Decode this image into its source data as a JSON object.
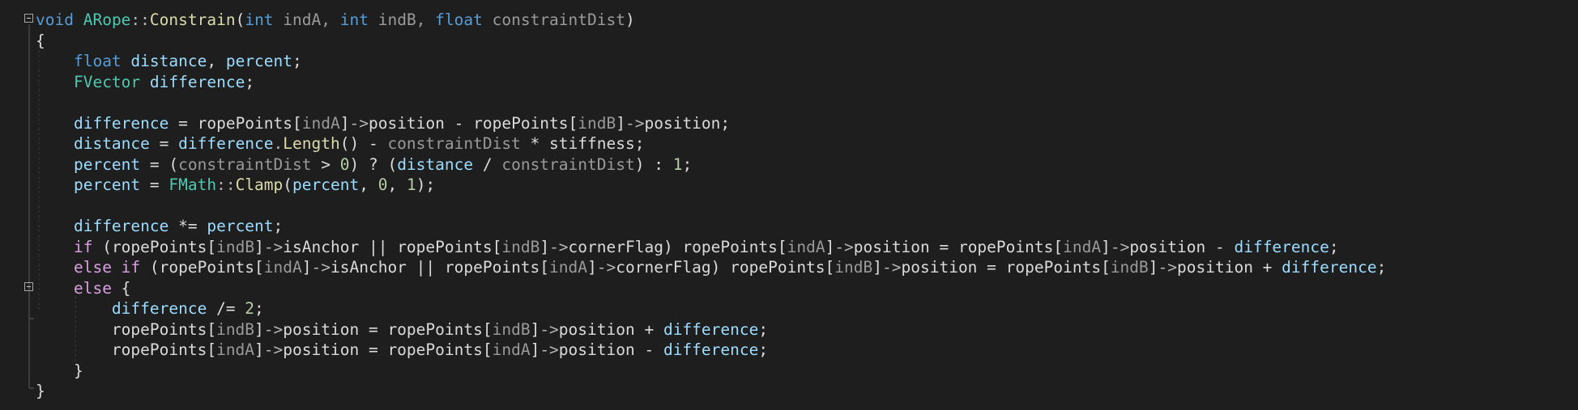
{
  "editor": {
    "language": "C++",
    "colors": {
      "background": "#1e1e1e",
      "keyword": "#569cd6",
      "control": "#d8a0df",
      "type": "#4ec9b0",
      "function": "#dcdcaa",
      "variable": "#9cdcfe",
      "parameter": "#9a9a9a",
      "number": "#b5cea8",
      "operator": "#b4b4b4",
      "member": "#dadada"
    },
    "fold_markers": [
      "collapse-icon",
      "collapse-icon"
    ],
    "lines": [
      [
        [
          "void",
          "keyword"
        ],
        [
          " ",
          "punct"
        ],
        [
          "ARope",
          "type"
        ],
        [
          "::",
          "operator"
        ],
        [
          "Constrain",
          "function"
        ],
        [
          "(",
          "punct"
        ],
        [
          "int",
          "keyword"
        ],
        [
          " indA, ",
          "parameter"
        ],
        [
          "int",
          "keyword"
        ],
        [
          " indB, ",
          "parameter"
        ],
        [
          "float",
          "keyword"
        ],
        [
          " constraintDist",
          "parameter"
        ],
        [
          ")",
          "punct"
        ]
      ],
      [
        [
          "{",
          "punct"
        ]
      ],
      [
        [
          "    ",
          "punct"
        ],
        [
          "float",
          "keyword"
        ],
        [
          " ",
          "punct"
        ],
        [
          "distance",
          "variable"
        ],
        [
          ", ",
          "punct"
        ],
        [
          "percent",
          "variable"
        ],
        [
          ";",
          "punct"
        ]
      ],
      [
        [
          "    ",
          "punct"
        ],
        [
          "FVector",
          "type"
        ],
        [
          " ",
          "punct"
        ],
        [
          "difference",
          "variable"
        ],
        [
          ";",
          "punct"
        ]
      ],
      [],
      [
        [
          "    ",
          "punct"
        ],
        [
          "difference",
          "variable"
        ],
        [
          " = ",
          "punct"
        ],
        [
          "ropePoints",
          "member"
        ],
        [
          "[",
          "punct"
        ],
        [
          "indA",
          "parameter"
        ],
        [
          "]",
          "punct"
        ],
        [
          "->",
          "operator"
        ],
        [
          "position",
          "member"
        ],
        [
          " - ",
          "punct"
        ],
        [
          "ropePoints",
          "member"
        ],
        [
          "[",
          "punct"
        ],
        [
          "indB",
          "parameter"
        ],
        [
          "]",
          "punct"
        ],
        [
          "->",
          "operator"
        ],
        [
          "position",
          "member"
        ],
        [
          ";",
          "punct"
        ]
      ],
      [
        [
          "    ",
          "punct"
        ],
        [
          "distance",
          "variable"
        ],
        [
          " = ",
          "punct"
        ],
        [
          "difference",
          "variable"
        ],
        [
          ".",
          "operator"
        ],
        [
          "Length",
          "function"
        ],
        [
          "() - ",
          "punct"
        ],
        [
          "constraintDist",
          "parameter"
        ],
        [
          " * ",
          "punct"
        ],
        [
          "stiffness",
          "member"
        ],
        [
          ";",
          "punct"
        ]
      ],
      [
        [
          "    ",
          "punct"
        ],
        [
          "percent",
          "variable"
        ],
        [
          " = (",
          "punct"
        ],
        [
          "constraintDist",
          "parameter"
        ],
        [
          " > ",
          "punct"
        ],
        [
          "0",
          "number"
        ],
        [
          ") ? (",
          "punct"
        ],
        [
          "distance",
          "variable"
        ],
        [
          " / ",
          "punct"
        ],
        [
          "constraintDist",
          "parameter"
        ],
        [
          ") : ",
          "punct"
        ],
        [
          "1",
          "number"
        ],
        [
          ";",
          "punct"
        ]
      ],
      [
        [
          "    ",
          "punct"
        ],
        [
          "percent",
          "variable"
        ],
        [
          " = ",
          "punct"
        ],
        [
          "FMath",
          "type"
        ],
        [
          "::",
          "operator"
        ],
        [
          "Clamp",
          "function"
        ],
        [
          "(",
          "punct"
        ],
        [
          "percent",
          "variable"
        ],
        [
          ", ",
          "punct"
        ],
        [
          "0",
          "number"
        ],
        [
          ", ",
          "punct"
        ],
        [
          "1",
          "number"
        ],
        [
          ");",
          "punct"
        ]
      ],
      [],
      [
        [
          "    ",
          "punct"
        ],
        [
          "difference",
          "variable"
        ],
        [
          " *= ",
          "punct"
        ],
        [
          "percent",
          "variable"
        ],
        [
          ";",
          "punct"
        ]
      ],
      [
        [
          "    ",
          "punct"
        ],
        [
          "if",
          "control"
        ],
        [
          " (",
          "punct"
        ],
        [
          "ropePoints",
          "member"
        ],
        [
          "[",
          "punct"
        ],
        [
          "indB",
          "parameter"
        ],
        [
          "]",
          "punct"
        ],
        [
          "->",
          "operator"
        ],
        [
          "isAnchor",
          "member"
        ],
        [
          " || ",
          "punct"
        ],
        [
          "ropePoints",
          "member"
        ],
        [
          "[",
          "punct"
        ],
        [
          "indB",
          "parameter"
        ],
        [
          "]",
          "punct"
        ],
        [
          "->",
          "operator"
        ],
        [
          "cornerFlag",
          "member"
        ],
        [
          ") ",
          "punct"
        ],
        [
          "ropePoints",
          "member"
        ],
        [
          "[",
          "punct"
        ],
        [
          "indA",
          "parameter"
        ],
        [
          "]",
          "punct"
        ],
        [
          "->",
          "operator"
        ],
        [
          "position",
          "member"
        ],
        [
          " = ",
          "punct"
        ],
        [
          "ropePoints",
          "member"
        ],
        [
          "[",
          "punct"
        ],
        [
          "indA",
          "parameter"
        ],
        [
          "]",
          "punct"
        ],
        [
          "->",
          "operator"
        ],
        [
          "position",
          "member"
        ],
        [
          " - ",
          "punct"
        ],
        [
          "difference",
          "variable"
        ],
        [
          ";",
          "punct"
        ]
      ],
      [
        [
          "    ",
          "punct"
        ],
        [
          "else if",
          "control"
        ],
        [
          " (",
          "punct"
        ],
        [
          "ropePoints",
          "member"
        ],
        [
          "[",
          "punct"
        ],
        [
          "indA",
          "parameter"
        ],
        [
          "]",
          "punct"
        ],
        [
          "->",
          "operator"
        ],
        [
          "isAnchor",
          "member"
        ],
        [
          " || ",
          "punct"
        ],
        [
          "ropePoints",
          "member"
        ],
        [
          "[",
          "punct"
        ],
        [
          "indA",
          "parameter"
        ],
        [
          "]",
          "punct"
        ],
        [
          "->",
          "operator"
        ],
        [
          "cornerFlag",
          "member"
        ],
        [
          ") ",
          "punct"
        ],
        [
          "ropePoints",
          "member"
        ],
        [
          "[",
          "punct"
        ],
        [
          "indB",
          "parameter"
        ],
        [
          "]",
          "punct"
        ],
        [
          "->",
          "operator"
        ],
        [
          "position",
          "member"
        ],
        [
          " = ",
          "punct"
        ],
        [
          "ropePoints",
          "member"
        ],
        [
          "[",
          "punct"
        ],
        [
          "indB",
          "parameter"
        ],
        [
          "]",
          "punct"
        ],
        [
          "->",
          "operator"
        ],
        [
          "position",
          "member"
        ],
        [
          " + ",
          "punct"
        ],
        [
          "difference",
          "variable"
        ],
        [
          ";",
          "punct"
        ]
      ],
      [
        [
          "    ",
          "punct"
        ],
        [
          "else",
          "control"
        ],
        [
          " {",
          "punct"
        ]
      ],
      [
        [
          "        ",
          "punct"
        ],
        [
          "difference",
          "variable"
        ],
        [
          " /= ",
          "punct"
        ],
        [
          "2",
          "number"
        ],
        [
          ";",
          "punct"
        ]
      ],
      [
        [
          "        ",
          "punct"
        ],
        [
          "ropePoints",
          "member"
        ],
        [
          "[",
          "punct"
        ],
        [
          "indB",
          "parameter"
        ],
        [
          "]",
          "punct"
        ],
        [
          "->",
          "operator"
        ],
        [
          "position",
          "member"
        ],
        [
          " = ",
          "punct"
        ],
        [
          "ropePoints",
          "member"
        ],
        [
          "[",
          "punct"
        ],
        [
          "indB",
          "parameter"
        ],
        [
          "]",
          "punct"
        ],
        [
          "->",
          "operator"
        ],
        [
          "position",
          "member"
        ],
        [
          " + ",
          "punct"
        ],
        [
          "difference",
          "variable"
        ],
        [
          ";",
          "punct"
        ]
      ],
      [
        [
          "        ",
          "punct"
        ],
        [
          "ropePoints",
          "member"
        ],
        [
          "[",
          "punct"
        ],
        [
          "indA",
          "parameter"
        ],
        [
          "]",
          "punct"
        ],
        [
          "->",
          "operator"
        ],
        [
          "position",
          "member"
        ],
        [
          " = ",
          "punct"
        ],
        [
          "ropePoints",
          "member"
        ],
        [
          "[",
          "punct"
        ],
        [
          "indA",
          "parameter"
        ],
        [
          "]",
          "punct"
        ],
        [
          "->",
          "operator"
        ],
        [
          "position",
          "member"
        ],
        [
          " - ",
          "punct"
        ],
        [
          "difference",
          "variable"
        ],
        [
          ";",
          "punct"
        ]
      ],
      [
        [
          "    ",
          "punct"
        ],
        [
          "}",
          "punct"
        ]
      ],
      [
        [
          "}",
          "punct"
        ]
      ]
    ]
  }
}
